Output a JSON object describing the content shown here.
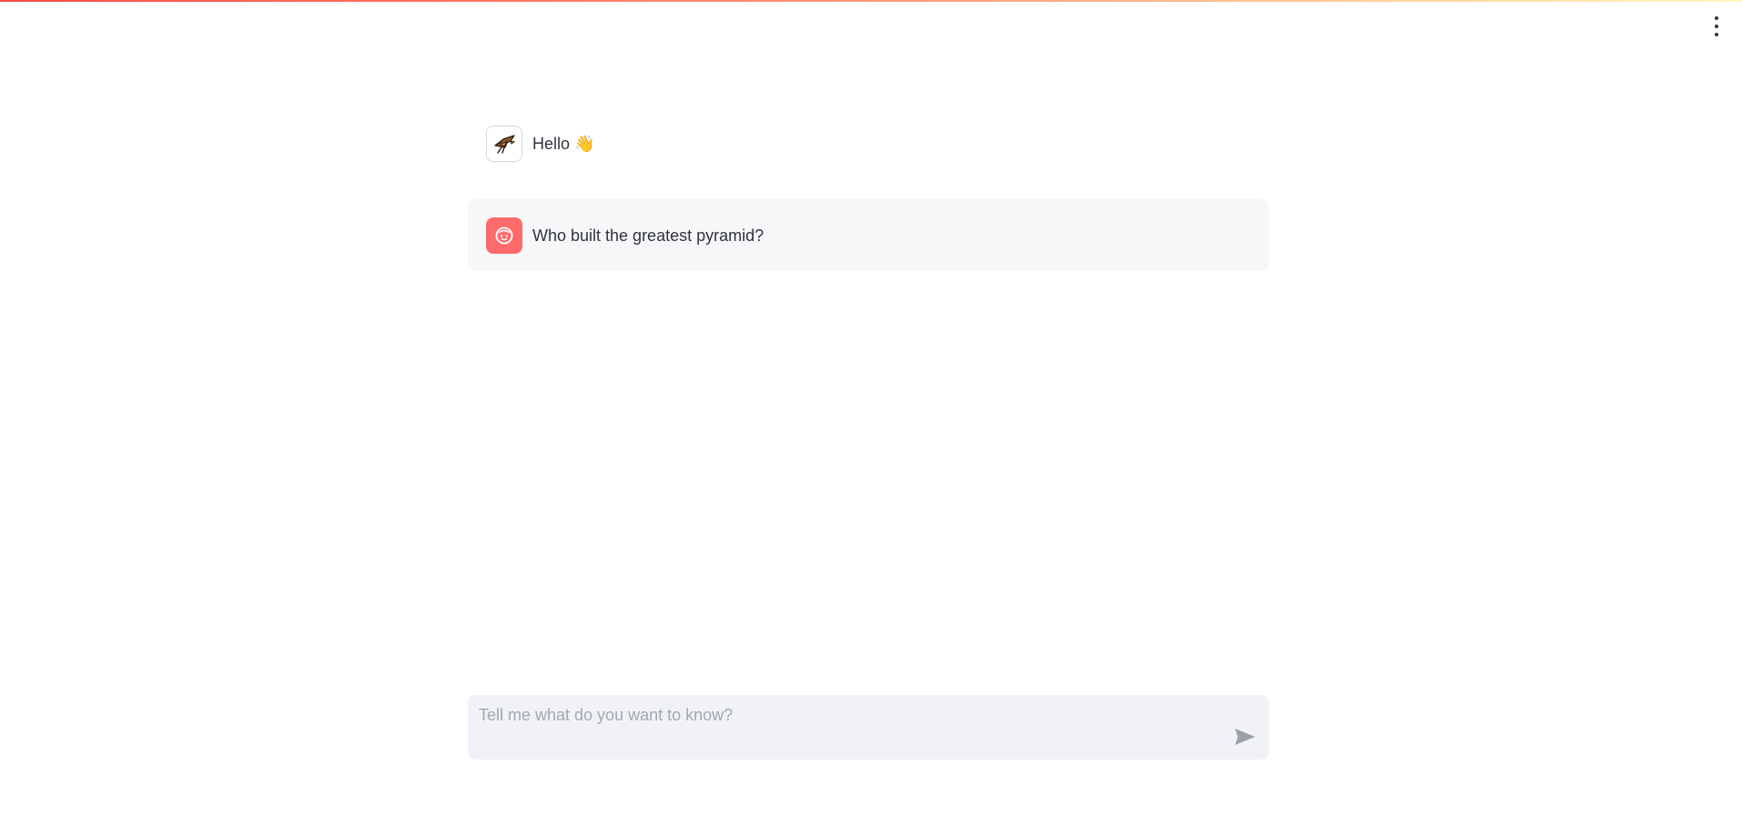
{
  "header": {
    "menu_icon": "kebab-menu-icon",
    "accent_gradient": [
      "#ff4b4b",
      "#ff8f6b",
      "#fff7c0"
    ]
  },
  "messages": [
    {
      "role": "assistant",
      "avatar_icon": "eagle-icon",
      "text": "Hello 👋"
    },
    {
      "role": "user",
      "avatar_icon": "smiley-face-icon",
      "avatar_color": "#ff6b6b",
      "text": "Who built the greatest pyramid?"
    }
  ],
  "chat_input": {
    "placeholder": "Tell me what do you want to know?",
    "value": "",
    "send_icon": "send-arrow-icon"
  }
}
